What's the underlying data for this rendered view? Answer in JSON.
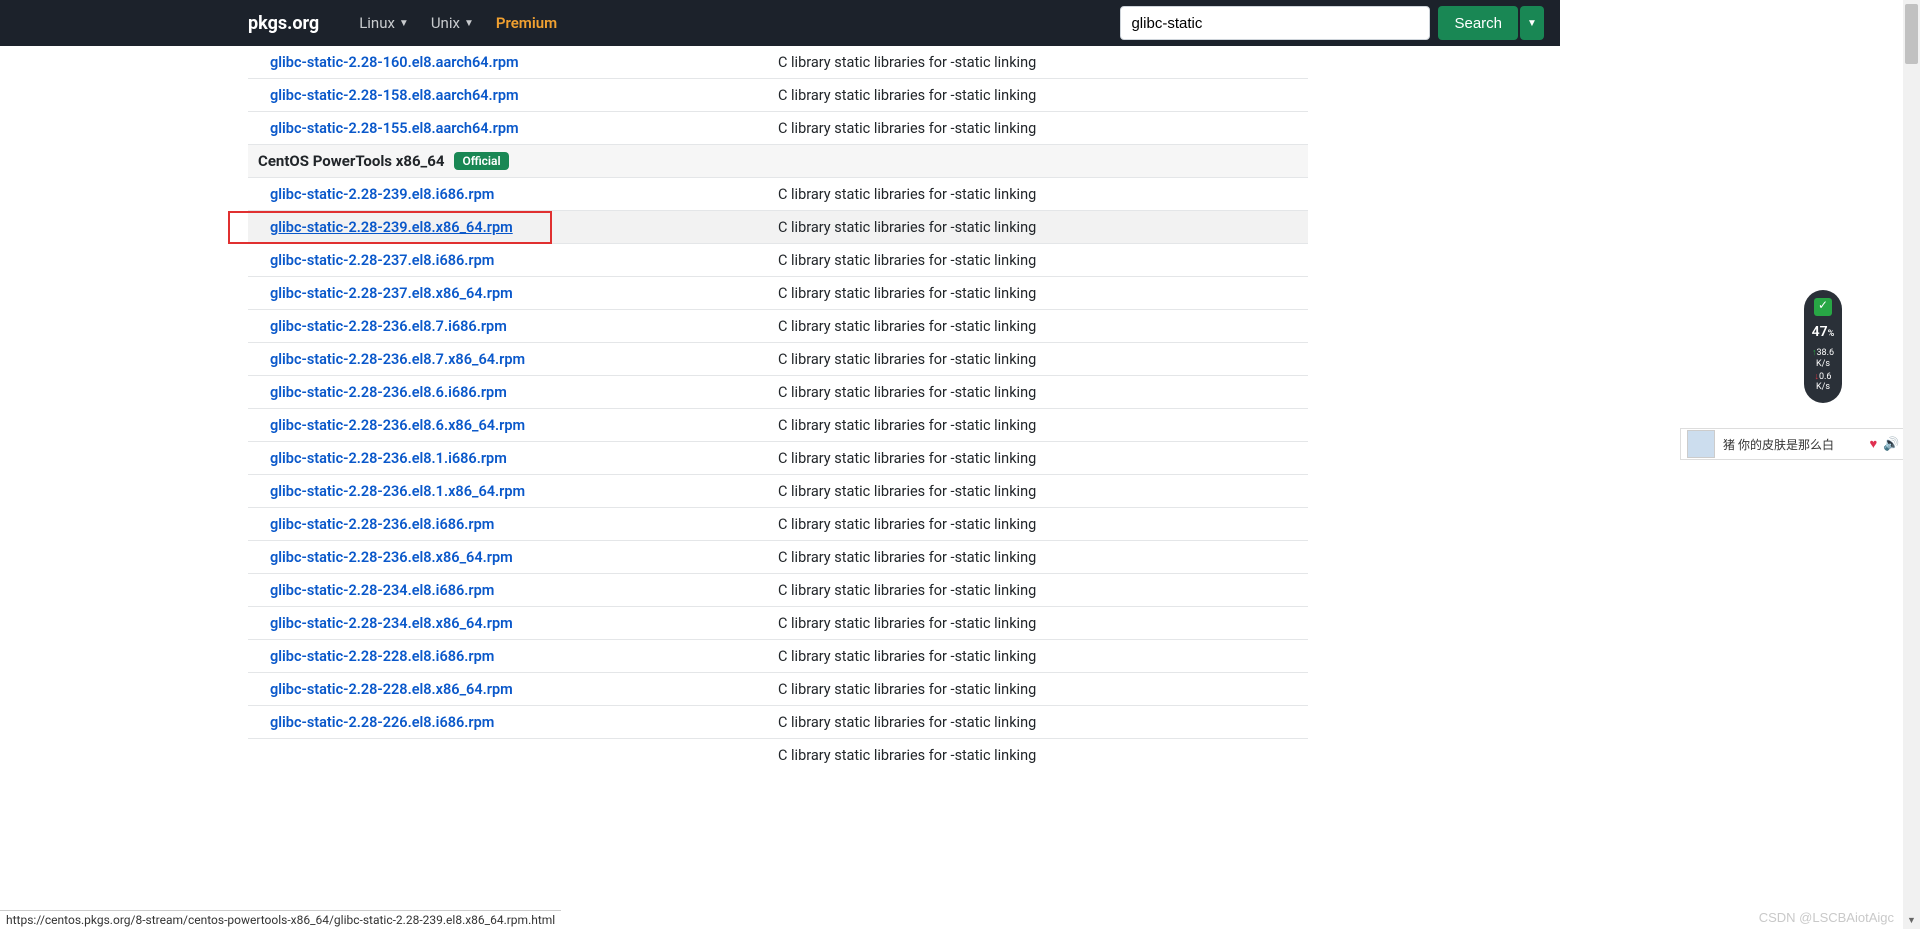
{
  "navbar": {
    "brand": "pkgs.org",
    "linux": "Linux",
    "unix": "Unix",
    "premium": "Premium"
  },
  "search": {
    "value": "glibc-static",
    "button": "Search"
  },
  "section1_rows": [
    {
      "pkg": "glibc-static-2.28-160.el8.aarch64.rpm",
      "desc": "C library static libraries for -static linking"
    },
    {
      "pkg": "glibc-static-2.28-158.el8.aarch64.rpm",
      "desc": "C library static libraries for -static linking"
    },
    {
      "pkg": "glibc-static-2.28-155.el8.aarch64.rpm",
      "desc": "C library static libraries for -static linking"
    }
  ],
  "section_header": {
    "title": "CentOS PowerTools x86_64",
    "badge": "Official"
  },
  "section2_rows": [
    {
      "pkg": "glibc-static-2.28-239.el8.i686.rpm",
      "desc": "C library static libraries for -static linking",
      "hl": false
    },
    {
      "pkg": "glibc-static-2.28-239.el8.x86_64.rpm",
      "desc": "C library static libraries for -static linking",
      "hl": true
    },
    {
      "pkg": "glibc-static-2.28-237.el8.i686.rpm",
      "desc": "C library static libraries for -static linking",
      "hl": false
    },
    {
      "pkg": "glibc-static-2.28-237.el8.x86_64.rpm",
      "desc": "C library static libraries for -static linking",
      "hl": false
    },
    {
      "pkg": "glibc-static-2.28-236.el8.7.i686.rpm",
      "desc": "C library static libraries for -static linking",
      "hl": false
    },
    {
      "pkg": "glibc-static-2.28-236.el8.7.x86_64.rpm",
      "desc": "C library static libraries for -static linking",
      "hl": false
    },
    {
      "pkg": "glibc-static-2.28-236.el8.6.i686.rpm",
      "desc": "C library static libraries for -static linking",
      "hl": false
    },
    {
      "pkg": "glibc-static-2.28-236.el8.6.x86_64.rpm",
      "desc": "C library static libraries for -static linking",
      "hl": false
    },
    {
      "pkg": "glibc-static-2.28-236.el8.1.i686.rpm",
      "desc": "C library static libraries for -static linking",
      "hl": false
    },
    {
      "pkg": "glibc-static-2.28-236.el8.1.x86_64.rpm",
      "desc": "C library static libraries for -static linking",
      "hl": false
    },
    {
      "pkg": "glibc-static-2.28-236.el8.i686.rpm",
      "desc": "C library static libraries for -static linking",
      "hl": false
    },
    {
      "pkg": "glibc-static-2.28-236.el8.x86_64.rpm",
      "desc": "C library static libraries for -static linking",
      "hl": false
    },
    {
      "pkg": "glibc-static-2.28-234.el8.i686.rpm",
      "desc": "C library static libraries for -static linking",
      "hl": false
    },
    {
      "pkg": "glibc-static-2.28-234.el8.x86_64.rpm",
      "desc": "C library static libraries for -static linking",
      "hl": false
    },
    {
      "pkg": "glibc-static-2.28-228.el8.i686.rpm",
      "desc": "C library static libraries for -static linking",
      "hl": false
    },
    {
      "pkg": "glibc-static-2.28-228.el8.x86_64.rpm",
      "desc": "C library static libraries for -static linking",
      "hl": false
    },
    {
      "pkg": "glibc-static-2.28-226.el8.i686.rpm",
      "desc": "C library static libraries for -static linking",
      "hl": false
    }
  ],
  "cut_row_desc": "C library static libraries for -static linking",
  "statusbar_url": "https://centos.pkgs.org/8-stream/centos-powertools-x86_64/glibc-static-2.28-239.el8.x86_64.rpm.html",
  "widget": {
    "pct": "47",
    "pct_unit": "%",
    "up": "38.6",
    "up_unit": "K/s",
    "down": "0.6",
    "down_unit": "K/s"
  },
  "music": {
    "title": "猪 你的皮肤是那么白"
  },
  "watermark": "CSDN @LSCBAiotAigc"
}
